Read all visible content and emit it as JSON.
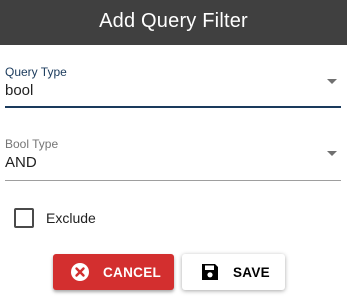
{
  "dialog": {
    "title": "Add Query Filter"
  },
  "query_type": {
    "label": "Query Type",
    "value": "bool"
  },
  "bool_type": {
    "label": "Bool Type",
    "value": "AND"
  },
  "exclude": {
    "label": "Exclude",
    "checked": false
  },
  "actions": {
    "cancel_label": "CANCEL",
    "save_label": "SAVE"
  },
  "colors": {
    "titlebar": "#404040",
    "focused_field": "#1a3a5c",
    "cancel_button": "#d32f2f",
    "save_button": "#ffffff"
  },
  "icons": {
    "cancel": "close-circle-icon",
    "save": "floppy-disk-icon",
    "dropdown": "caret-down-icon"
  }
}
